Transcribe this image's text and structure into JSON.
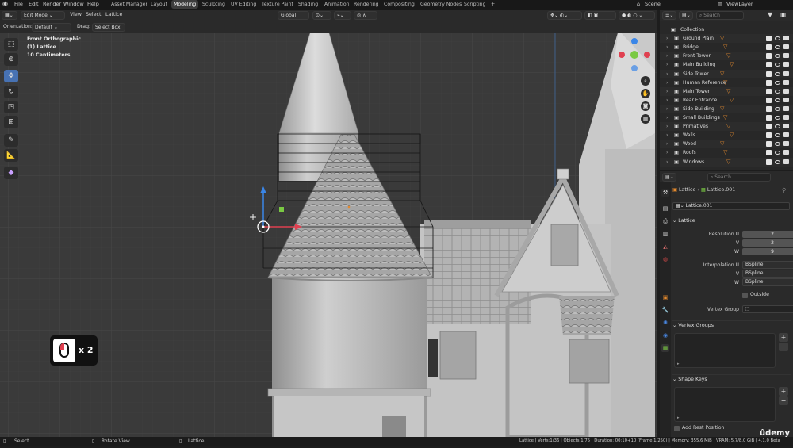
{
  "menu": {
    "items": [
      "File",
      "Edit",
      "Render",
      "Window",
      "Help"
    ],
    "workspaces": [
      "Asset Manager",
      "Layout",
      "Modeling",
      "Sculpting",
      "UV Editing",
      "Texture Paint",
      "Shading",
      "Animation",
      "Rendering",
      "Compositing",
      "Geometry Nodes",
      "Scripting"
    ],
    "active_workspace": "Modeling",
    "add_tab": "+",
    "scene": "Scene",
    "view_layer": "ViewLayer"
  },
  "viewport_header": {
    "mode": "Edit Mode",
    "menus": [
      "View",
      "Select",
      "Lattice"
    ],
    "transform_orientation": "Global"
  },
  "tool_settings": {
    "orientation_label": "Orientation:",
    "orientation_value": "Default",
    "drag_label": "Drag:",
    "drag_value": "Select Box"
  },
  "viewport_info": {
    "view": "Front Orthographic",
    "object": "(1) Lattice",
    "scale": "10 Centimeters"
  },
  "click_overlay": {
    "text": "x 2"
  },
  "outliner": {
    "search_placeholder": "Search",
    "root": "Collection",
    "items": [
      {
        "name": "Ground Plain"
      },
      {
        "name": "Bridge"
      },
      {
        "name": "Front Tower"
      },
      {
        "name": "Main Building"
      },
      {
        "name": "Side Tower"
      },
      {
        "name": "Human Reference"
      },
      {
        "name": "Main Tower"
      },
      {
        "name": "Rear Entrance"
      },
      {
        "name": "Side Building"
      },
      {
        "name": "Small Buildings"
      },
      {
        "name": "Primatives"
      },
      {
        "name": "Walls"
      },
      {
        "name": "Wood"
      },
      {
        "name": "Roofs"
      },
      {
        "name": "Windows"
      }
    ]
  },
  "properties": {
    "search_placeholder": "Search",
    "breadcrumb": [
      "Lattice",
      "Lattice.001"
    ],
    "datablock": "Lattice.001",
    "panel_lattice": "Lattice",
    "resolution_label": "Resolution U",
    "v_label": "V",
    "w_label": "W",
    "resolution_u": "2",
    "resolution_v": "2",
    "resolution_w": "9",
    "interpolation_label": "Interpolation U",
    "interp_u": "BSpline",
    "interp_v": "BSpline",
    "interp_w": "BSpline",
    "outside_label": "Outside",
    "vertex_group_label": "Vertex Group",
    "panel_vertex_groups": "Vertex Groups",
    "panel_shape_keys": "Shape Keys",
    "add_rest_position": "Add Rest Position"
  },
  "statusbar": {
    "select": "Select",
    "rotate": "Rotate View",
    "lattice": "Lattice",
    "stats": "Lattice | Verts:1/36 | Objects:1/75 | Duration: 00:10+10 (Frame 1/250) | Memory: 355.6 MiB | VRAM: 5.7/8.0 GiB | 4.1.0 Beta",
    "watermark": "ûdemy"
  },
  "colors": {
    "accent": "#4772b3",
    "lattice_orange": "#e58a2d",
    "gizmo_x": "#e04050",
    "gizmo_y": "#7ac943",
    "gizmo_z": "#3a86e8"
  }
}
